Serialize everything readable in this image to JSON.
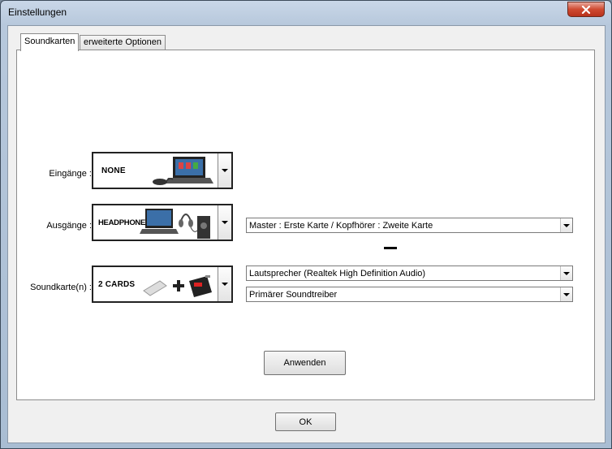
{
  "window": {
    "title": "Einstellungen",
    "close_label": "✕"
  },
  "tabs": [
    {
      "label": "Soundkarten",
      "active": true
    },
    {
      "label": "erweiterte Optionen",
      "active": false
    }
  ],
  "rows": {
    "inputs": {
      "label": "Eingänge :",
      "image_text": "NONE"
    },
    "outputs": {
      "label": "Ausgänge :",
      "image_text": "HEADPHONES",
      "mode_value": "Master : Erste Karte / Kopfhörer : Zweite Karte"
    },
    "soundcards": {
      "label": "Soundkarte(n) :",
      "image_text": "2 CARDS",
      "device_value": "Lautsprecher (Realtek High Definition Audio)",
      "driver_value": "Primärer Soundtreiber"
    }
  },
  "buttons": {
    "apply": "Anwenden",
    "ok": "OK"
  },
  "colors": {
    "close_button": "#cf4a31",
    "titlebar": "#b7c8dc",
    "panel": "#ffffff"
  }
}
